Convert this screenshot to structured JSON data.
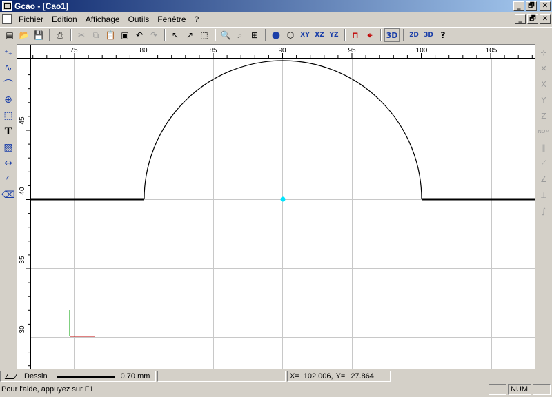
{
  "window": {
    "title": "Gcao - [Cao1]"
  },
  "window_buttons": [
    "_",
    "🗗",
    "✕"
  ],
  "menu": {
    "items": [
      {
        "key": "F",
        "rest": "ichier"
      },
      {
        "key": "E",
        "rest": "dition"
      },
      {
        "key": "A",
        "rest": "ffichage"
      },
      {
        "key": "O",
        "rest": "utils"
      },
      {
        "key": "",
        "rest": "Fenêtre"
      },
      {
        "key": "?",
        "rest": ""
      }
    ]
  },
  "toolbar": {
    "buttons": [
      {
        "icon": "new-document-icon",
        "glyph": "▤"
      },
      {
        "icon": "open-folder-icon",
        "glyph": "📂"
      },
      {
        "icon": "save-icon",
        "glyph": "💾"
      },
      {
        "icon": "print-icon",
        "glyph": "⎙"
      },
      {
        "icon": "cut-icon",
        "glyph": "✂"
      },
      {
        "icon": "copy-icon",
        "glyph": "⧉"
      },
      {
        "icon": "paste-icon",
        "glyph": "📋"
      },
      {
        "icon": "properties-icon",
        "glyph": "▣"
      },
      {
        "icon": "undo-icon",
        "glyph": "↶"
      },
      {
        "icon": "redo-icon",
        "glyph": "↷"
      },
      {
        "icon": "select-arrow-icon",
        "glyph": "↖"
      },
      {
        "icon": "select-curve-icon",
        "glyph": "↗"
      },
      {
        "icon": "select-window-icon",
        "glyph": "⬚"
      },
      {
        "icon": "zoom-window-icon",
        "glyph": "🔍"
      },
      {
        "icon": "zoom-dynamic-icon",
        "glyph": "⌕"
      },
      {
        "icon": "zoom-extents-icon",
        "glyph": "⊞"
      },
      {
        "icon": "render-sphere-icon",
        "glyph": "●"
      },
      {
        "icon": "iso-view-icon",
        "glyph": "⬡"
      },
      {
        "icon": "plane-xy-icon",
        "glyph": "XY"
      },
      {
        "icon": "plane-xz-icon",
        "glyph": "XZ"
      },
      {
        "icon": "plane-yz-icon",
        "glyph": "YZ"
      },
      {
        "icon": "snap-magnet-icon",
        "glyph": "⊓"
      },
      {
        "icon": "snap-point-icon",
        "glyph": "⌖"
      },
      {
        "icon": "view-3d-icon",
        "glyph": "3D"
      },
      {
        "icon": "export-2d-icon",
        "glyph": "2D"
      },
      {
        "icon": "export-3d-icon",
        "glyph": "3D"
      },
      {
        "icon": "help-context-icon",
        "glyph": "?"
      }
    ]
  },
  "left_tools": [
    {
      "icon": "point-tool-icon",
      "glyph": "⁺₊"
    },
    {
      "icon": "polyline-tool-icon",
      "glyph": "∿"
    },
    {
      "icon": "curve-tool-icon",
      "glyph": "⌒"
    },
    {
      "icon": "circle-tool-icon",
      "glyph": "⊕"
    },
    {
      "icon": "rectangle-tool-icon",
      "glyph": "⬚"
    },
    {
      "icon": "text-tool-icon",
      "glyph": "T"
    },
    {
      "icon": "hatch-tool-icon",
      "glyph": "▨"
    },
    {
      "icon": "dimension-tool-icon",
      "glyph": "↔"
    },
    {
      "icon": "fillet-tool-icon",
      "glyph": "◜"
    },
    {
      "icon": "eraser-tool-icon",
      "glyph": "⌫"
    }
  ],
  "right_tools": [
    {
      "icon": "snap-end-icon",
      "glyph": "⊹"
    },
    {
      "icon": "snap-intersect-icon",
      "glyph": "✕"
    },
    {
      "icon": "snap-x-icon",
      "glyph": "X"
    },
    {
      "icon": "snap-y-icon",
      "glyph": "Y"
    },
    {
      "icon": "snap-z-icon",
      "glyph": "Z"
    },
    {
      "icon": "snap-nom-icon",
      "glyph": "NOM"
    },
    {
      "icon": "snap-parallel-icon",
      "glyph": "∥"
    },
    {
      "icon": "snap-tangent-icon",
      "glyph": "⟋"
    },
    {
      "icon": "snap-angle-icon",
      "glyph": "∠"
    },
    {
      "icon": "snap-perpendicular-icon",
      "glyph": "⊥"
    },
    {
      "icon": "snap-curve-icon",
      "glyph": "∫"
    }
  ],
  "ruler": {
    "x_labels": [
      "75",
      "80",
      "85",
      "90",
      "95",
      "100",
      "105"
    ],
    "y_labels": [
      "45",
      "40",
      "35",
      "30"
    ]
  },
  "status": {
    "layer": "Dessin",
    "line_width": "0.70 mm",
    "coord_x_label": "X=",
    "coord_x": "102.006,",
    "coord_y_label": "Y=",
    "coord_y": "27.864",
    "help": "Pour l'aide, appuyez sur F1",
    "num": "NUM"
  },
  "colors": {
    "center_point": "#00e5ff",
    "axis_x": "#c00000",
    "axis_y": "#00a000",
    "grid": "#c8c8c8"
  }
}
